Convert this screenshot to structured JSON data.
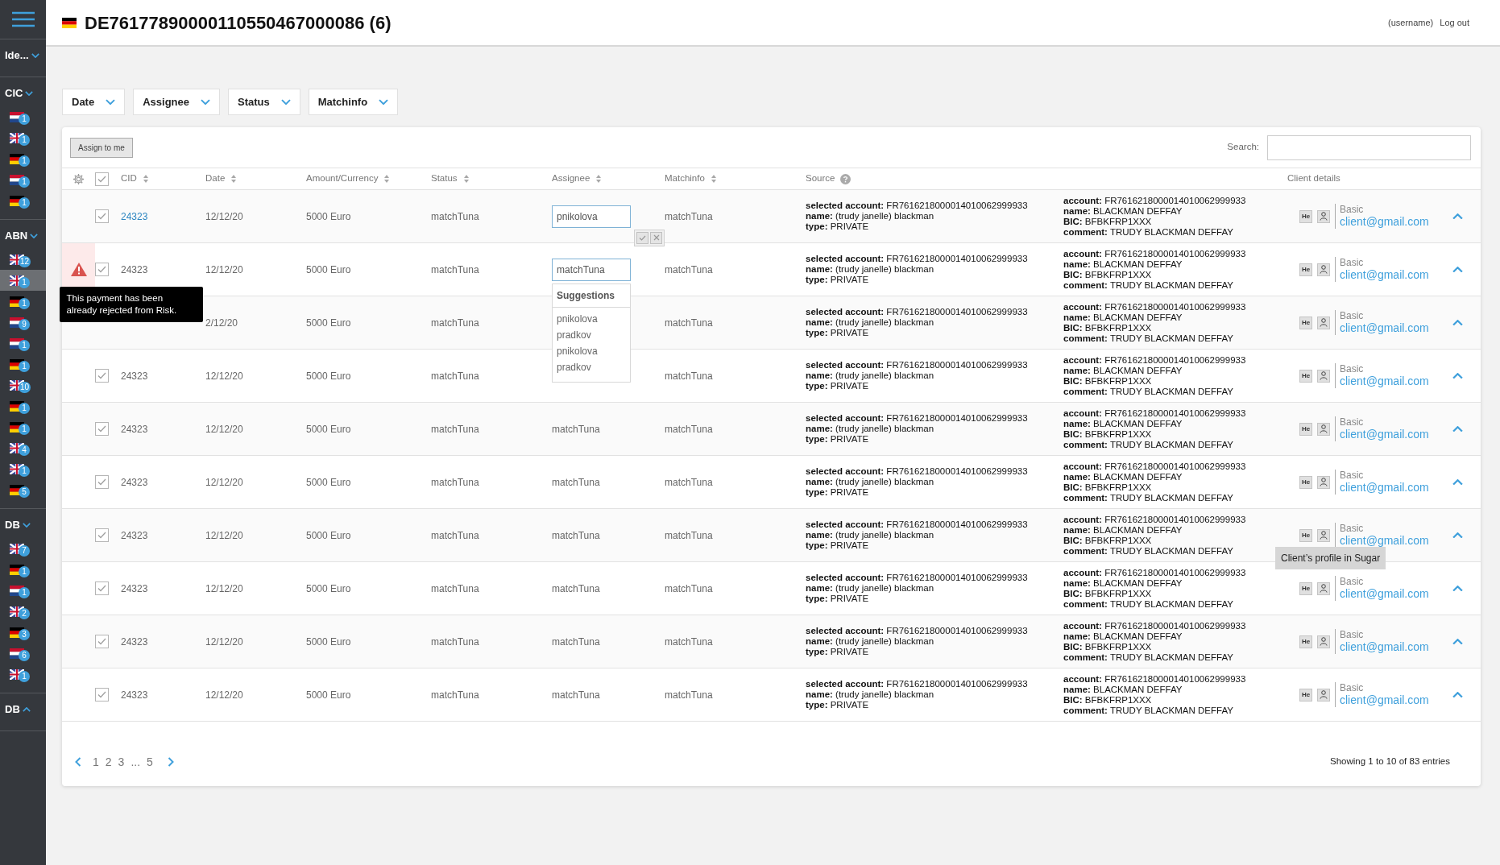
{
  "sidebar": {
    "groups": [
      {
        "label": "Ide...",
        "expanded": true
      },
      {
        "label": "CIC",
        "expanded": true,
        "items": [
          {
            "kind": "nl",
            "count": "1",
            "selected": false
          },
          {
            "kind": "uk",
            "count": "1",
            "selected": false
          },
          {
            "kind": "de",
            "count": "1",
            "selected": false
          },
          {
            "kind": "nl",
            "count": "1",
            "selected": false
          },
          {
            "kind": "de",
            "count": "1",
            "selected": false
          }
        ]
      },
      {
        "label": "ABN",
        "expanded": true,
        "items": [
          {
            "kind": "uk",
            "count": "12",
            "selected": false
          },
          {
            "kind": "uk",
            "count": "1",
            "selected": true
          },
          {
            "kind": "de",
            "count": "1",
            "selected": false
          },
          {
            "kind": "nl",
            "count": "9",
            "selected": false
          },
          {
            "kind": "nl",
            "count": "1",
            "selected": false
          },
          {
            "kind": "de",
            "count": "1",
            "selected": false
          },
          {
            "kind": "uk",
            "count": "10",
            "selected": false
          },
          {
            "kind": "de",
            "count": "1",
            "selected": false
          },
          {
            "kind": "de",
            "count": "1",
            "selected": false
          },
          {
            "kind": "uk",
            "count": "4",
            "selected": false
          },
          {
            "kind": "uk",
            "count": "1",
            "selected": false
          },
          {
            "kind": "de",
            "count": "5",
            "selected": false
          }
        ]
      },
      {
        "label": "DB",
        "expanded": true,
        "items": [
          {
            "kind": "uk",
            "count": "7",
            "selected": false
          },
          {
            "kind": "de",
            "count": "1",
            "selected": false
          },
          {
            "kind": "nl",
            "count": "1",
            "selected": false
          },
          {
            "kind": "uk",
            "count": "2",
            "selected": false
          },
          {
            "kind": "de",
            "count": "3",
            "selected": false
          },
          {
            "kind": "nl",
            "count": "6",
            "selected": false
          },
          {
            "kind": "uk",
            "count": "1",
            "selected": false
          }
        ]
      },
      {
        "label": "DB",
        "expanded": false
      }
    ]
  },
  "header": {
    "kind": "de",
    "title": "DE76177890000110550467000086 (6)",
    "user": "(username)",
    "logout": "Log out"
  },
  "filters": [
    "Date",
    "Assignee",
    "Status",
    "Matchinfo"
  ],
  "toolbar": {
    "assign_button": "Assign to me",
    "search_label": "Search:"
  },
  "columns": [
    {
      "label": "CID",
      "kind": "sort"
    },
    {
      "label": "Date",
      "kind": "sort"
    },
    {
      "label": "Amount/Currency",
      "kind": "sort"
    },
    {
      "label": "Status",
      "kind": "sort"
    },
    {
      "label": "Assignee",
      "kind": "sort"
    },
    {
      "label": "Matchinfo",
      "kind": "sort"
    },
    {
      "label": "Source",
      "kind": "help"
    },
    {
      "label": "Client details",
      "kind": "plain"
    }
  ],
  "header_checked": true,
  "rows": [
    {
      "cid": "24323",
      "cid_link": true,
      "checked": true,
      "warning": false,
      "date": "12/12/20",
      "amount": "5000 Euro",
      "status": "matchTuna",
      "assignee": {
        "kind": "edit",
        "value": "pnikolova"
      },
      "matchinfo": "matchTuna",
      "source": [
        {
          "label": "selected account:",
          "value": "FR7616218000014010062999933"
        },
        {
          "label": "name:",
          "value": "(trudy janelle) blackman"
        },
        {
          "label": "type:",
          "value": "PRIVATE"
        }
      ],
      "account": [
        {
          "label": "account:",
          "value": "FR7616218000014010062999933"
        },
        {
          "label": "name:",
          "value": "BLACKMAN DEFFAY"
        },
        {
          "label": "BIC:",
          "value": "BFBKFRP1XXX"
        },
        {
          "label": "comment:",
          "value": "TRUDY BLACKMAN DEFFAY"
        }
      ],
      "client": {
        "badge": "He",
        "tier": "Basic",
        "email": "client@gmail.com"
      }
    },
    {
      "cid": "24323",
      "cid_link": false,
      "checked": true,
      "warning": true,
      "warning_tooltip": "This payment has been already rejected from Risk.",
      "date": "12/12/20",
      "amount": "5000 Euro",
      "status": "matchTuna",
      "assignee": {
        "kind": "suggest",
        "value": "matchTuna",
        "title": "Suggestions",
        "suggestions": [
          "pnikolova",
          "pradkov",
          "pnikolova",
          "pradkov"
        ]
      },
      "matchinfo": "matchTuna",
      "source": [
        {
          "label": "selected account:",
          "value": "FR7616218000014010062999933"
        },
        {
          "label": "name:",
          "value": "(trudy janelle) blackman"
        },
        {
          "label": "type:",
          "value": "PRIVATE"
        }
      ],
      "account": [
        {
          "label": "account:",
          "value": "FR7616218000014010062999933"
        },
        {
          "label": "name:",
          "value": "BLACKMAN DEFFAY"
        },
        {
          "label": "BIC:",
          "value": "BFBKFRP1XXX"
        },
        {
          "label": "comment:",
          "value": "TRUDY BLACKMAN DEFFAY"
        }
      ],
      "client": {
        "badge": "He",
        "tier": "Basic",
        "email": "client@gmail.com"
      }
    },
    {
      "warning": false,
      "date": "2/12/20",
      "amount": "5000 Euro",
      "status": "matchTuna",
      "assignee": {
        "kind": "hidden"
      },
      "matchinfo": "matchTuna",
      "source": [
        {
          "label": "selected account:",
          "value": "FR7616218000014010062999933"
        },
        {
          "label": "name:",
          "value": "(trudy janelle) blackman"
        },
        {
          "label": "type:",
          "value": "PRIVATE"
        }
      ],
      "account": [
        {
          "label": "account:",
          "value": "FR7616218000014010062999933"
        },
        {
          "label": "name:",
          "value": "BLACKMAN DEFFAY"
        },
        {
          "label": "BIC:",
          "value": "BFBKFRP1XXX"
        },
        {
          "label": "comment:",
          "value": "TRUDY BLACKMAN DEFFAY"
        }
      ],
      "client": {
        "badge": "He",
        "tier": "Basic",
        "email": "client@gmail.com"
      }
    },
    {
      "cid": "24323",
      "cid_link": false,
      "checked": true,
      "warning": false,
      "date": "12/12/20",
      "amount": "5000 Euro",
      "status": "matchTuna",
      "assignee": {
        "kind": "hidden"
      },
      "matchinfo": "matchTuna",
      "source": [
        {
          "label": "selected account:",
          "value": "FR7616218000014010062999933"
        },
        {
          "label": "name:",
          "value": "(trudy janelle) blackman"
        },
        {
          "label": "type:",
          "value": "PRIVATE"
        }
      ],
      "account": [
        {
          "label": "account:",
          "value": "FR7616218000014010062999933"
        },
        {
          "label": "name:",
          "value": "BLACKMAN DEFFAY"
        },
        {
          "label": "BIC:",
          "value": "BFBKFRP1XXX"
        },
        {
          "label": "comment:",
          "value": "TRUDY BLACKMAN DEFFAY"
        }
      ],
      "client": {
        "badge": "He",
        "tier": "Basic",
        "email": "client@gmail.com"
      }
    },
    {
      "cid": "24323",
      "cid_link": false,
      "checked": true,
      "warning": false,
      "date": "12/12/20",
      "amount": "5000 Euro",
      "status": "matchTuna",
      "assignee": {
        "kind": "text",
        "value": "matchTuna"
      },
      "matchinfo": "matchTuna",
      "source": [
        {
          "label": "selected account:",
          "value": "FR7616218000014010062999933"
        },
        {
          "label": "name:",
          "value": "(trudy janelle) blackman"
        },
        {
          "label": "type:",
          "value": "PRIVATE"
        }
      ],
      "account": [
        {
          "label": "account:",
          "value": "FR7616218000014010062999933"
        },
        {
          "label": "name:",
          "value": "BLACKMAN DEFFAY"
        },
        {
          "label": "BIC:",
          "value": "BFBKFRP1XXX"
        },
        {
          "label": "comment:",
          "value": "TRUDY BLACKMAN DEFFAY"
        }
      ],
      "client": {
        "badge": "He",
        "tier": "Basic",
        "email": "client@gmail.com"
      }
    },
    {
      "cid": "24323",
      "cid_link": false,
      "checked": true,
      "warning": false,
      "date": "12/12/20",
      "amount": "5000 Euro",
      "status": "matchTuna",
      "assignee": {
        "kind": "text",
        "value": "matchTuna"
      },
      "matchinfo": "matchTuna",
      "source": [
        {
          "label": "selected account:",
          "value": "FR7616218000014010062999933"
        },
        {
          "label": "name:",
          "value": "(trudy janelle) blackman"
        },
        {
          "label": "type:",
          "value": "PRIVATE"
        }
      ],
      "account": [
        {
          "label": "account:",
          "value": "FR7616218000014010062999933"
        },
        {
          "label": "name:",
          "value": "BLACKMAN DEFFAY"
        },
        {
          "label": "BIC:",
          "value": "BFBKFRP1XXX"
        },
        {
          "label": "comment:",
          "value": "TRUDY BLACKMAN DEFFAY"
        }
      ],
      "client": {
        "badge": "He",
        "tier": "Basic",
        "email": "client@gmail.com"
      }
    },
    {
      "cid": "24323",
      "cid_link": false,
      "checked": true,
      "warning": false,
      "date": "12/12/20",
      "amount": "5000 Euro",
      "status": "matchTuna",
      "assignee": {
        "kind": "text",
        "value": "matchTuna"
      },
      "matchinfo": "matchTuna",
      "source": [
        {
          "label": "selected account:",
          "value": "FR7616218000014010062999933"
        },
        {
          "label": "name:",
          "value": "(trudy janelle) blackman"
        },
        {
          "label": "type:",
          "value": "PRIVATE"
        }
      ],
      "account": [
        {
          "label": "account:",
          "value": "FR7616218000014010062999933"
        },
        {
          "label": "name:",
          "value": "BLACKMAN DEFFAY"
        },
        {
          "label": "BIC:",
          "value": "BFBKFRP1XXX"
        },
        {
          "label": "comment:",
          "value": "TRUDY BLACKMAN DEFFAY"
        }
      ],
      "client": {
        "badge": "He",
        "tier": "Basic",
        "email": "client@gmail.com",
        "profile_tooltip": "Client’s profile in Sugar"
      }
    },
    {
      "cid": "24323",
      "cid_link": false,
      "checked": true,
      "warning": false,
      "date": "12/12/20",
      "amount": "5000 Euro",
      "status": "matchTuna",
      "assignee": {
        "kind": "text",
        "value": "matchTuna"
      },
      "matchinfo": "matchTuna",
      "source": [
        {
          "label": "selected account:",
          "value": "FR7616218000014010062999933"
        },
        {
          "label": "name:",
          "value": "(trudy janelle) blackman"
        },
        {
          "label": "type:",
          "value": "PRIVATE"
        }
      ],
      "account": [
        {
          "label": "account:",
          "value": "FR7616218000014010062999933"
        },
        {
          "label": "name:",
          "value": "BLACKMAN DEFFAY"
        },
        {
          "label": "BIC:",
          "value": "BFBKFRP1XXX"
        },
        {
          "label": "comment:",
          "value": "TRUDY BLACKMAN DEFFAY"
        }
      ],
      "client": {
        "badge": "He",
        "tier": "Basic",
        "email": "client@gmail.com"
      }
    },
    {
      "cid": "24323",
      "cid_link": false,
      "checked": true,
      "warning": false,
      "date": "12/12/20",
      "amount": "5000 Euro",
      "status": "matchTuna",
      "assignee": {
        "kind": "text",
        "value": "matchTuna"
      },
      "matchinfo": "matchTuna",
      "source": [
        {
          "label": "selected account:",
          "value": "FR7616218000014010062999933"
        },
        {
          "label": "name:",
          "value": "(trudy janelle) blackman"
        },
        {
          "label": "type:",
          "value": "PRIVATE"
        }
      ],
      "account": [
        {
          "label": "account:",
          "value": "FR7616218000014010062999933"
        },
        {
          "label": "name:",
          "value": "BLACKMAN DEFFAY"
        },
        {
          "label": "BIC:",
          "value": "BFBKFRP1XXX"
        },
        {
          "label": "comment:",
          "value": "TRUDY BLACKMAN DEFFAY"
        }
      ],
      "client": {
        "badge": "He",
        "tier": "Basic",
        "email": "client@gmail.com"
      }
    },
    {
      "cid": "24323",
      "cid_link": false,
      "checked": true,
      "warning": false,
      "date": "12/12/20",
      "amount": "5000 Euro",
      "status": "matchTuna",
      "assignee": {
        "kind": "text",
        "value": "matchTuna"
      },
      "matchinfo": "matchTuna",
      "source": [
        {
          "label": "selected account:",
          "value": "FR7616218000014010062999933"
        },
        {
          "label": "name:",
          "value": "(trudy janelle) blackman"
        },
        {
          "label": "type:",
          "value": "PRIVATE"
        }
      ],
      "account": [
        {
          "label": "account:",
          "value": "FR7616218000014010062999933"
        },
        {
          "label": "name:",
          "value": "BLACKMAN DEFFAY"
        },
        {
          "label": "BIC:",
          "value": "BFBKFRP1XXX"
        },
        {
          "label": "comment:",
          "value": "TRUDY BLACKMAN DEFFAY"
        }
      ],
      "client": {
        "badge": "He",
        "tier": "Basic",
        "email": "client@gmail.com"
      }
    }
  ],
  "pagination": {
    "pages": [
      "1",
      "2",
      "3",
      "...",
      "5"
    ],
    "summary": "Showing 1 to 10 of 83 entries"
  }
}
